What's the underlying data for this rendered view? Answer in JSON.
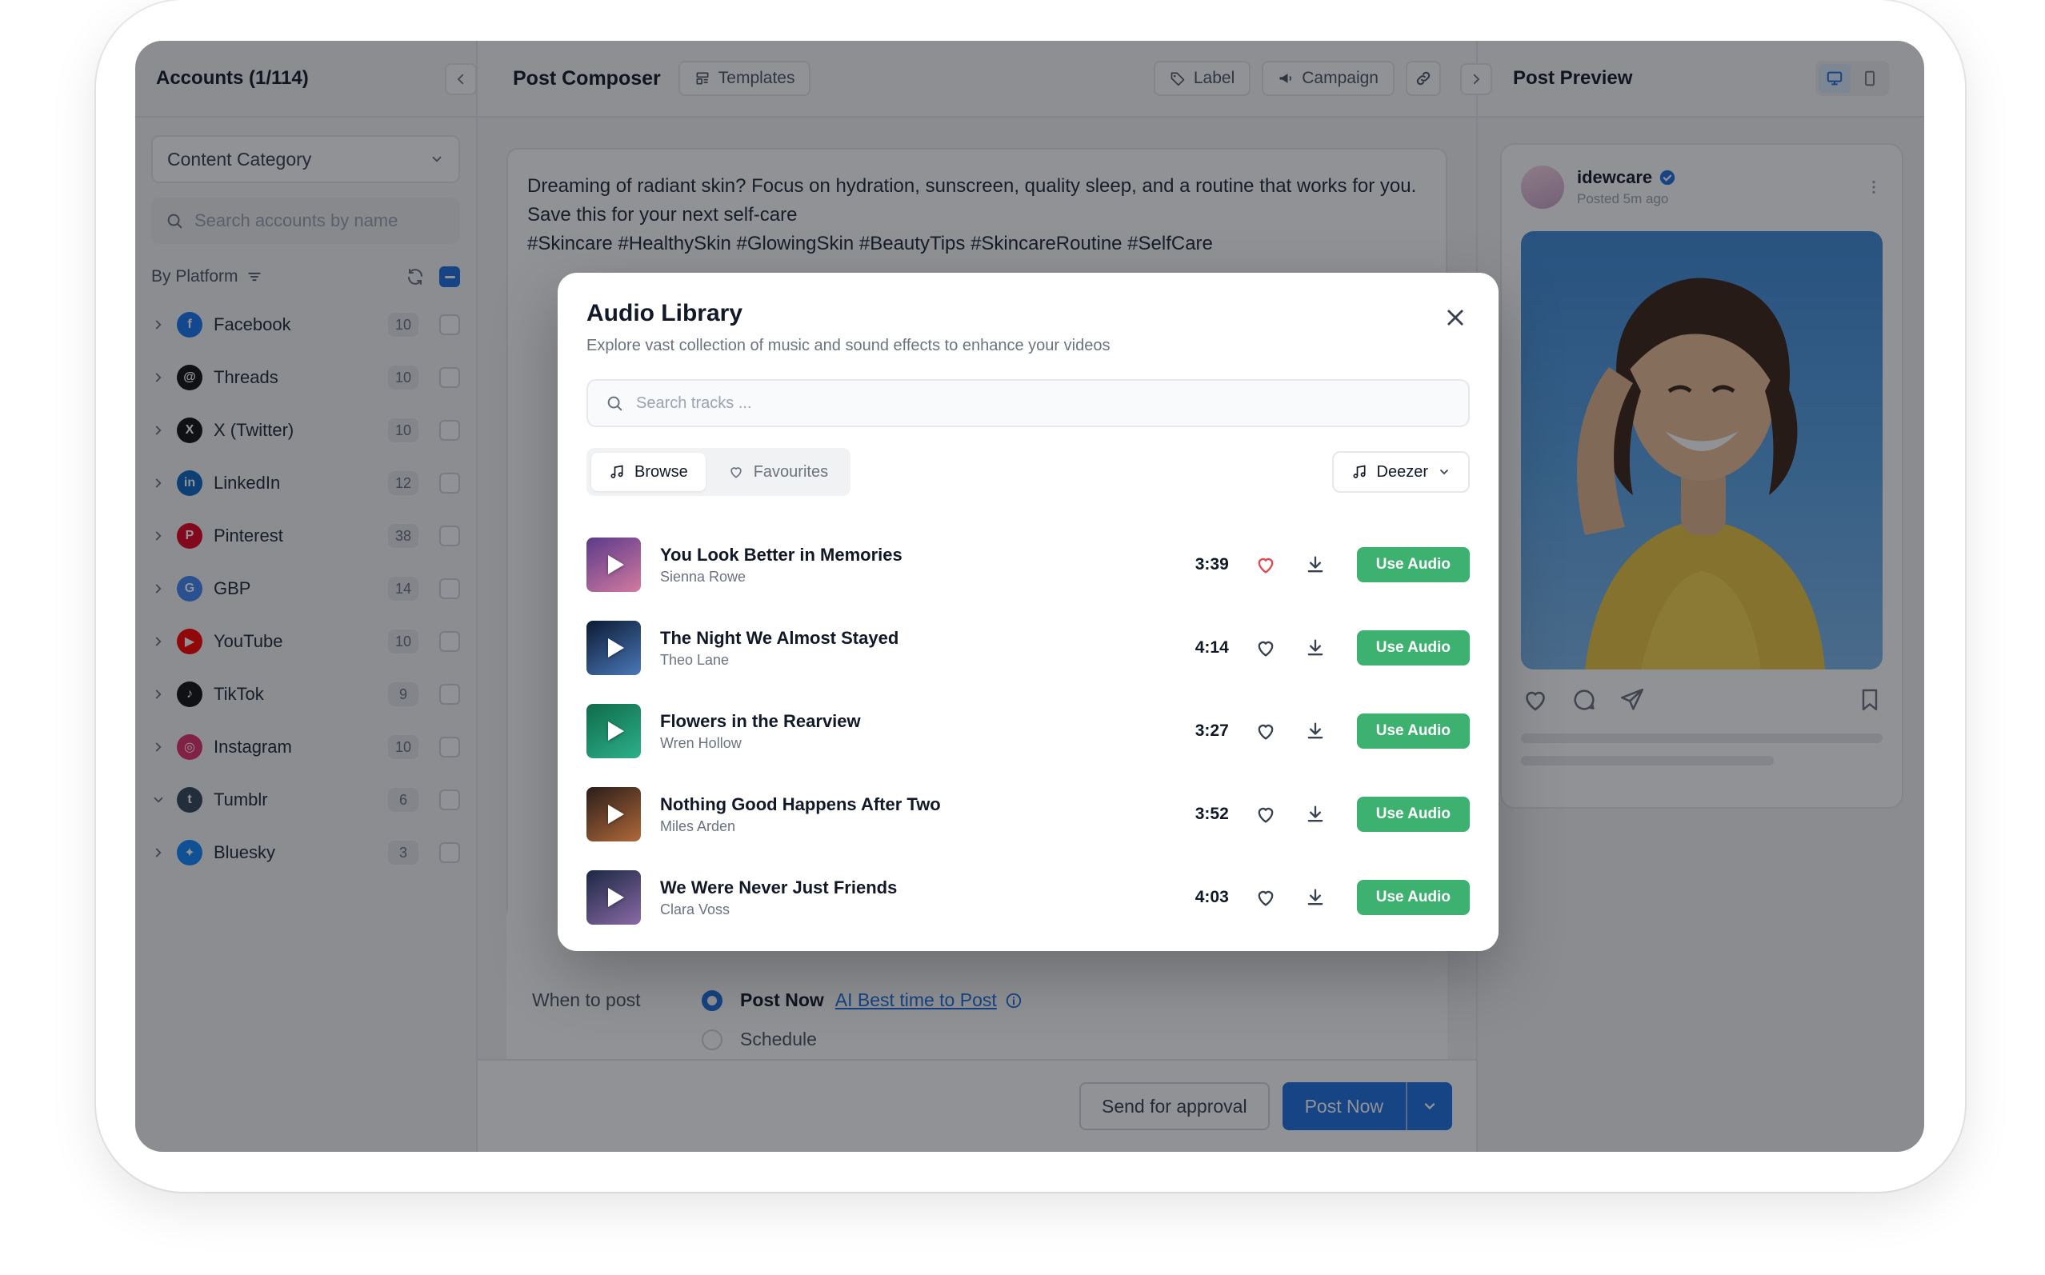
{
  "left": {
    "title": "Accounts (1/114)",
    "content_category": "Content Category",
    "search_placeholder": "Search accounts by name",
    "by_platform": "By Platform",
    "platforms": [
      {
        "name": "Facebook",
        "count": "10",
        "color": "#1877F2",
        "glyph": "f",
        "expanded": false
      },
      {
        "name": "Threads",
        "count": "10",
        "color": "#111111",
        "glyph": "@",
        "expanded": false
      },
      {
        "name": "X (Twitter)",
        "count": "10",
        "color": "#111111",
        "glyph": "X",
        "expanded": false
      },
      {
        "name": "LinkedIn",
        "count": "12",
        "color": "#0A66C2",
        "glyph": "in",
        "expanded": false
      },
      {
        "name": "Pinterest",
        "count": "38",
        "color": "#E60023",
        "glyph": "P",
        "expanded": false
      },
      {
        "name": "GBP",
        "count": "14",
        "color": "#4285F4",
        "glyph": "G",
        "expanded": false
      },
      {
        "name": "YouTube",
        "count": "10",
        "color": "#FF0000",
        "glyph": "▶",
        "expanded": false
      },
      {
        "name": "TikTok",
        "count": "9",
        "color": "#111111",
        "glyph": "♪",
        "expanded": false
      },
      {
        "name": "Instagram",
        "count": "10",
        "color": "#E1306C",
        "glyph": "◎",
        "expanded": false
      },
      {
        "name": "Tumblr",
        "count": "6",
        "color": "#35465C",
        "glyph": "t",
        "expanded": true
      },
      {
        "name": "Bluesky",
        "count": "3",
        "color": "#1185FE",
        "glyph": "✦",
        "expanded": false
      }
    ]
  },
  "center": {
    "title": "Post Composer",
    "templates": "Templates",
    "label": "Label",
    "campaign": "Campaign",
    "post_text_1": "Dreaming of radiant skin? Focus on hydration, sunscreen, quality sleep, and a routine that works for you. Save this for your next self-care",
    "post_text_2": "#Skincare #HealthySkin #GlowingSkin #BeautyTips #SkincareRoutine #SelfCare",
    "when_to_post": "When to post",
    "post_now_option": "Post Now",
    "ai_best_time": "AI Best time to Post",
    "schedule_option": "Schedule",
    "send_approval": "Send for approval",
    "post_now_btn": "Post Now"
  },
  "right": {
    "title": "Post Preview",
    "username": "idewcare",
    "posted": "Posted 5m ago"
  },
  "modal": {
    "title": "Audio Library",
    "subtitle": "Explore vast collection of music and sound effects to enhance your videos",
    "search_placeholder": "Search tracks ...",
    "tab_browse": "Browse",
    "tab_favourites": "Favourites",
    "source": "Deezer",
    "use_label": "Use Audio",
    "tracks": [
      {
        "title": "You Look Better in Memories",
        "artist": "Sienna Rowe",
        "duration": "3:39",
        "favourite": true,
        "thumb": "#5b3a8a,#d27aa0"
      },
      {
        "title": "The Night We Almost Stayed",
        "artist": "Theo Lane",
        "duration": "4:14",
        "favourite": false,
        "thumb": "#0c1a33,#4a78b8"
      },
      {
        "title": "Flowers in the Rearview",
        "artist": "Wren Hollow",
        "duration": "3:27",
        "favourite": false,
        "thumb": "#0f6b4a,#2db08a"
      },
      {
        "title": "Nothing Good Happens After Two",
        "artist": "Miles Arden",
        "duration": "3:52",
        "favourite": false,
        "thumb": "#2a1d1a,#b0693a"
      },
      {
        "title": "We Were Never Just Friends",
        "artist": "Clara Voss",
        "duration": "4:03",
        "favourite": false,
        "thumb": "#1b2744,#8a6aa5"
      }
    ]
  },
  "colors": {
    "primary": "#1D6FE0",
    "use_audio": "#3DB170",
    "favourite": "#E5484D"
  }
}
